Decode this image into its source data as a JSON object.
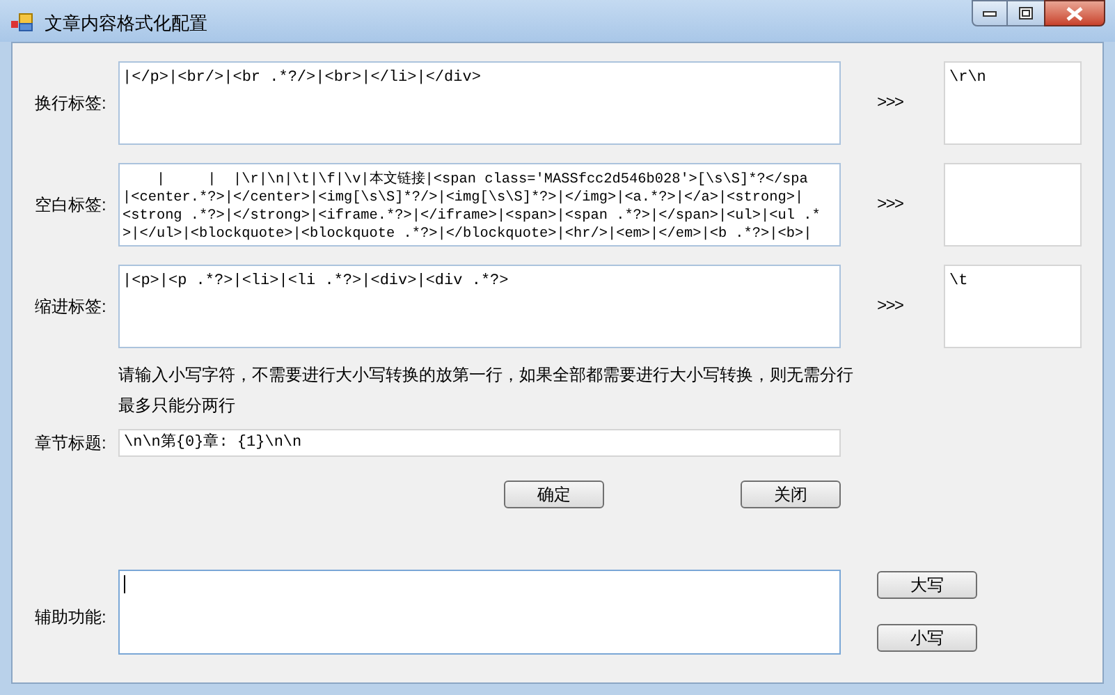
{
  "window": {
    "title": "文章内容格式化配置"
  },
  "rules": [
    {
      "label": "换行标签:",
      "lines": [
        "|</p>|<br/>|<br .*?/>|<br>|</li>|</div>"
      ],
      "arrow": ">>>",
      "target": "\\r\\n"
    },
    {
      "label": "空白标签:",
      "lines": [
        "    |     |  |\\r|\\n|\\t|\\f|\\v|本文链接|<span class='MASSfcc2d546b028'>[\\s\\S]*?</spa",
        "|<center.*?>|</center>|<img[\\s\\S]*?/>|<img[\\s\\S]*?>|</img>|<a.*?>|</a>|<strong>|",
        "<strong .*?>|</strong>|<iframe.*?>|</iframe>|<span>|<span .*?>|</span>|<ul>|<ul .*",
        ">|</ul>|<blockquote>|<blockquote .*?>|</blockquote>|<hr/>|<em>|</em>|<b .*?>|<b>|"
      ],
      "arrow": ">>>"
    },
    {
      "label": "缩进标签:",
      "lines": [
        "|<p>|<p .*?>|<li>|<li .*?>|<div>|<div .*?>"
      ],
      "arrow": ">>>",
      "target": "\\t"
    }
  ],
  "hints": [
    "请输入小写字符，不需要进行大小写转换的放第一行，如果全部都需要进行大小写转换，则无需分行",
    "最多只能分两行"
  ],
  "chapter": {
    "label": "章节标题:",
    "value": "\\n\\n第{0}章: {1}\\n\\n"
  },
  "buttons": [
    "确定",
    "关闭"
  ],
  "assist": {
    "label": "辅助功能:",
    "buttons": [
      "大写",
      "小写"
    ]
  }
}
